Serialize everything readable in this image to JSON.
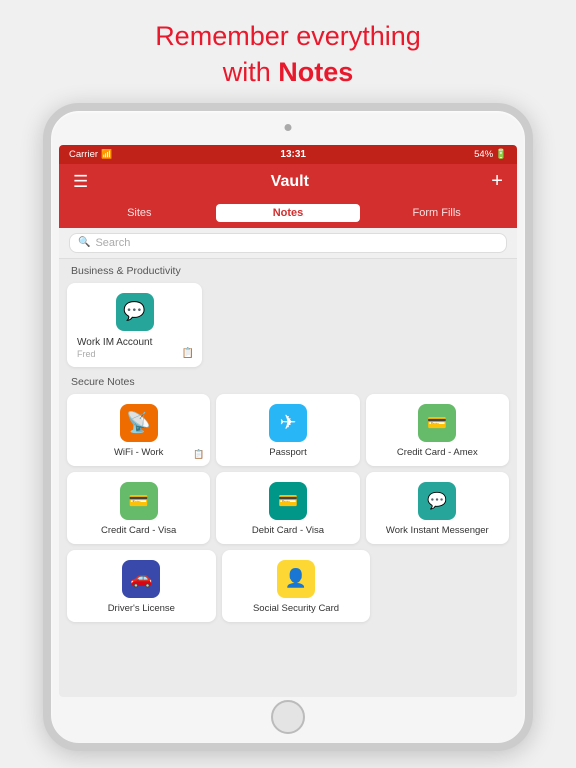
{
  "page": {
    "header_line1": "Remember everything",
    "header_line2": "with ",
    "header_bold": "Notes"
  },
  "statusbar": {
    "carrier": "Carrier",
    "time": "13:31",
    "battery": "54%"
  },
  "navbar": {
    "title": "Vault",
    "menu_icon": "☰",
    "add_icon": "+"
  },
  "tabs": [
    {
      "label": "Sites",
      "active": false
    },
    {
      "label": "Notes",
      "active": true
    },
    {
      "label": "Form Fills",
      "active": false
    }
  ],
  "search": {
    "placeholder": "Search"
  },
  "sections": [
    {
      "title": "Business & Productivity",
      "items": [
        {
          "id": "work-im",
          "label": "Work IM Account",
          "sublabel": "Fred",
          "icon_type": "teal",
          "icon_symbol": "💬",
          "has_note": true
        }
      ]
    },
    {
      "title": "Secure Notes",
      "items": [
        {
          "id": "wifi-work",
          "label": "WiFi - Work",
          "icon_type": "wifi",
          "has_note": true
        },
        {
          "id": "passport",
          "label": "Passport",
          "icon_type": "blue-light",
          "icon_symbol": "✈"
        },
        {
          "id": "credit-amex",
          "label": "Credit Card - Amex",
          "icon_type": "green",
          "icon_symbol": "💳"
        },
        {
          "id": "credit-visa",
          "label": "Credit Card - Visa",
          "icon_type": "green",
          "icon_symbol": "💳"
        },
        {
          "id": "debit-visa",
          "label": "Debit Card - Visa",
          "icon_type": "teal-dark",
          "icon_symbol": "💳"
        },
        {
          "id": "work-messenger",
          "label": "Work Instant Messenger",
          "icon_type": "teal",
          "icon_symbol": "💬"
        },
        {
          "id": "drivers-license",
          "label": "Driver's License",
          "icon_type": "navy",
          "icon_symbol": "🚗"
        },
        {
          "id": "social-security",
          "label": "Social Security Card",
          "icon_type": "yellow",
          "icon_symbol": "👤"
        }
      ]
    }
  ],
  "colors": {
    "accent": "#d32f2f",
    "status_bar": "#c0221a"
  }
}
